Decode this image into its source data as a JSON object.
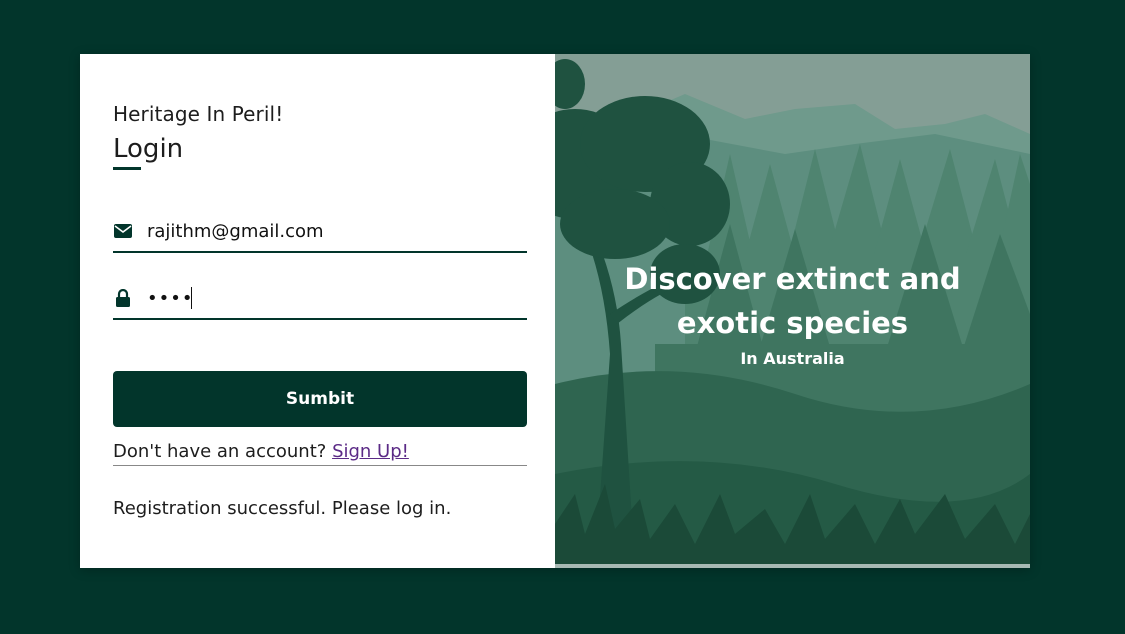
{
  "login": {
    "brand": "Heritage In Peril!",
    "heading": "Login",
    "email_value": "rajithm@gmail.com",
    "password_value": "••••",
    "submit_label": "Sumbit",
    "signup_prompt": "Don't have an account?",
    "signup_link": "Sign Up!",
    "status_message": "Registration successful. Please log in."
  },
  "hero": {
    "title_line1": "Discover extinct and",
    "title_line2": "exotic species",
    "subtitle": "In Australia"
  },
  "icons": {
    "email": "envelope-icon",
    "password": "lock-icon"
  },
  "colors": {
    "background": "#02352b",
    "accent": "#02352b",
    "link": "#5b2a86"
  }
}
